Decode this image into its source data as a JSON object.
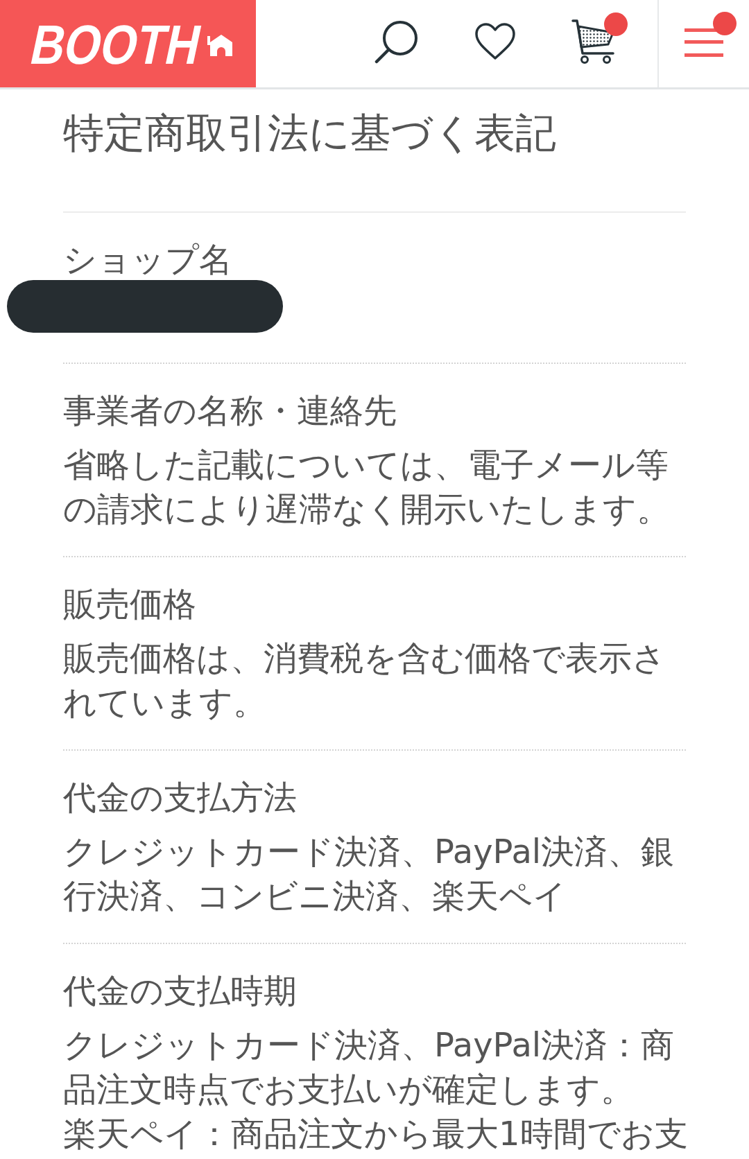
{
  "header": {
    "logo": "BOOTH",
    "actions": [
      {
        "kind": "search",
        "notification": false
      },
      {
        "kind": "favorites",
        "notification": false
      },
      {
        "kind": "cart",
        "notification": true
      },
      {
        "kind": "menu",
        "notification": true
      }
    ]
  },
  "title": "特定商取引法に基づく表記",
  "sections": [
    {
      "label": "ショップ名",
      "redacted": true
    },
    {
      "label": "事業者の名称・連絡先",
      "redacted": false,
      "paragraphs": [
        "省略した記載については、電子メール等の請求により遅滞なく開示いたします。"
      ]
    },
    {
      "label": "販売価格",
      "redacted": false,
      "paragraphs": [
        "販売価格は、消費税を含む価格で表示されています。"
      ]
    },
    {
      "label": "代金の支払方法",
      "redacted": false,
      "paragraphs": [
        "クレジットカード決済、PayPal決済、銀行決済、コンビニ決済、楽天ペイ"
      ]
    },
    {
      "label": "代金の支払時期",
      "redacted": false,
      "paragraphs": [
        "クレジットカード決済、PayPal決済：商品注文時点でお支払いが確定します。",
        "楽天ペイ：商品注文から最大1時間でお支"
      ]
    }
  ]
}
